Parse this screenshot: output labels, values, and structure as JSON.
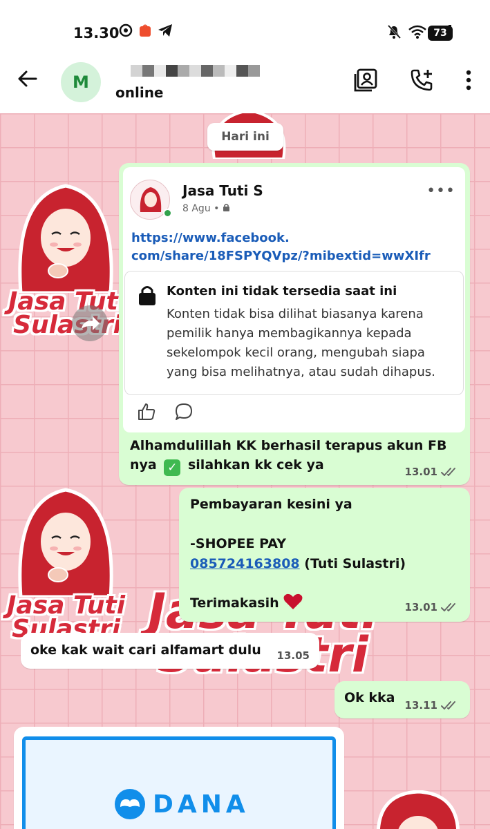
{
  "status_bar": {
    "time": "13.30",
    "battery": "73"
  },
  "header": {
    "avatar_letter": "M",
    "status": "online"
  },
  "date_divider": "Hari ini",
  "sticker_text": {
    "line1": "Jasa Tuti",
    "line2": "Sulastri"
  },
  "shared_post": {
    "page_name": "Jasa Tuti S",
    "post_date": "8 Agu",
    "link_line1": "https://www.facebook.",
    "link_line2": "com/share/18FSPYQVpz/?mibextid=wwXIfr",
    "notice_title": "Konten ini tidak tersedia saat ini",
    "notice_body": "Konten tidak bisa dilihat biasanya karena pemilik hanya membagikannya kepada sekelompok kecil orang, mengubah siapa yang bisa melihatnya, atau sudah dihapus."
  },
  "messages": [
    {
      "direction": "out",
      "line1_text": "Alhamdulillah KK berhasil terapus akun FB",
      "line2_before": "nya",
      "line2_after": "silahkan kk cek ya",
      "time": "13.01"
    },
    {
      "direction": "out",
      "line1": "Pembayaran kesini ya",
      "line2": "-SHOPEE PAY",
      "phone": "085724163808",
      "phone_suffix": "(Tuti Sulastri)",
      "line4": "Terimakasih",
      "time": "13.01"
    },
    {
      "direction": "in",
      "text": "oke kak wait cari alfamart dulu",
      "time": "13.05"
    },
    {
      "direction": "out",
      "text": "Ok kka",
      "time": "13.11"
    }
  ],
  "image_message": {
    "brand": "DANA"
  },
  "colors": {
    "bubble_out": "#d9fdd3",
    "link": "#1a5cb8",
    "wallpaper": "#f7c9cf",
    "sticker_red": "#d62a3a",
    "dana_blue": "#118eea"
  },
  "icons": [
    "back-arrow-icon",
    "contact-card-icon",
    "add-call-icon",
    "more-vert-icon",
    "like-icon",
    "comment-icon",
    "lock-icon",
    "check-mark-emoji",
    "heart-emoji",
    "double-tick-icon",
    "forward-icon"
  ]
}
